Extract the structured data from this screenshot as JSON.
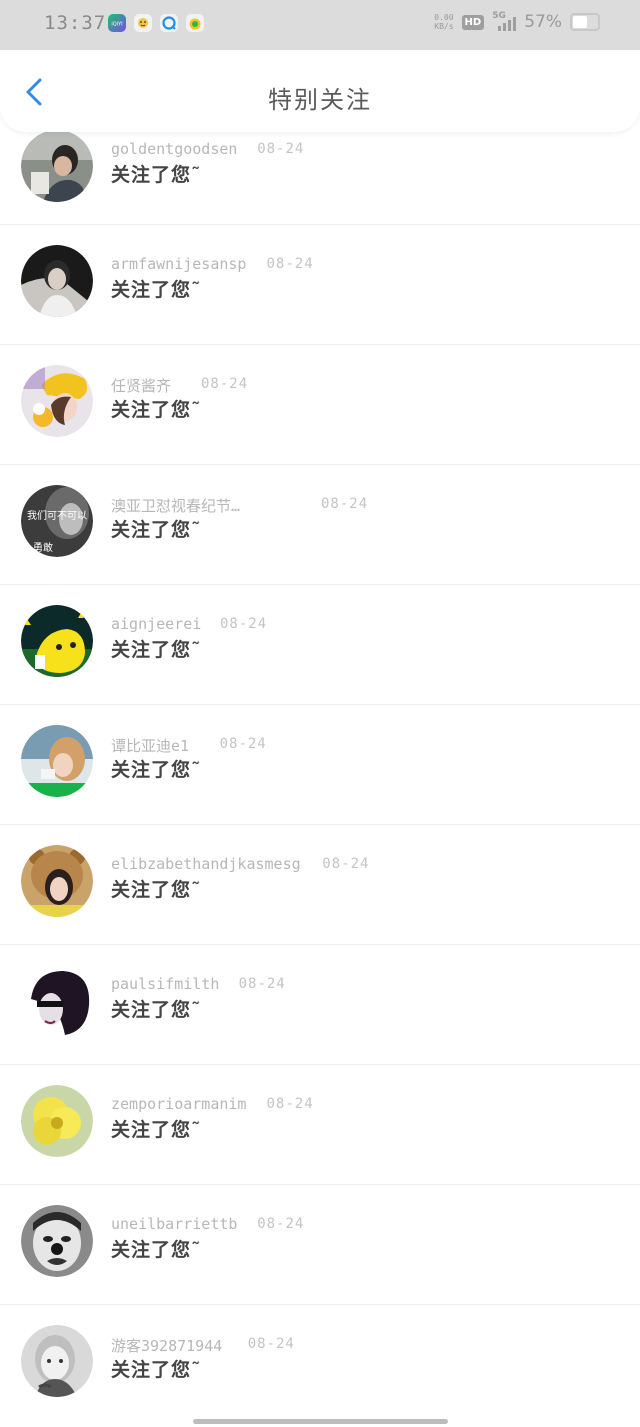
{
  "status": {
    "time": "13:37",
    "net_speed_top": "0.00",
    "net_speed_bottom": "KB/s",
    "hd": "HD",
    "network": "5G",
    "battery": "57%",
    "apps": [
      "iqiyi-app-icon",
      "baby-app-icon",
      "qq-browser-app-icon",
      "qq-music-app-icon"
    ]
  },
  "header": {
    "title": "特别关注"
  },
  "items": [
    {
      "name": "goldentgoodsen",
      "date": "08-24",
      "action": "关注了您˜",
      "avatar": "avatar-1"
    },
    {
      "name": "armfawnijesansp",
      "date": "08-24",
      "action": "关注了您˜",
      "avatar": "avatar-2"
    },
    {
      "name": "任贤酱齐",
      "date": "08-24",
      "action": "关注了您˜",
      "avatar": "avatar-3"
    },
    {
      "name": "澳亚卫怼视春纪节…",
      "date": "08-24",
      "action": "关注了您˜",
      "avatar": "avatar-4",
      "avatar_text": [
        "我们可不可以",
        "勇敢"
      ]
    },
    {
      "name": "aignjeerei",
      "date": "08-24",
      "action": "关注了您˜",
      "avatar": "avatar-5"
    },
    {
      "name": "谭比亚迪e1",
      "date": "08-24",
      "action": "关注了您˜",
      "avatar": "avatar-6"
    },
    {
      "name": "elibzabethandjkasmesg",
      "date": "08-24",
      "action": "关注了您˜",
      "avatar": "avatar-7"
    },
    {
      "name": "paulsifmilth",
      "date": "08-24",
      "action": "关注了您˜",
      "avatar": "avatar-8"
    },
    {
      "name": "zemporioarmanim",
      "date": "08-24",
      "action": "关注了您˜",
      "avatar": "avatar-9"
    },
    {
      "name": "uneilbarriettb",
      "date": "08-24",
      "action": "关注了您˜",
      "avatar": "avatar-10"
    },
    {
      "name": "游客392871944",
      "date": "08-24",
      "action": "关注了您˜",
      "avatar": "avatar-11"
    }
  ],
  "colors": {
    "accent": "#2f8de6",
    "background": "#ffffff",
    "statusbar": "#dcdcdc"
  }
}
